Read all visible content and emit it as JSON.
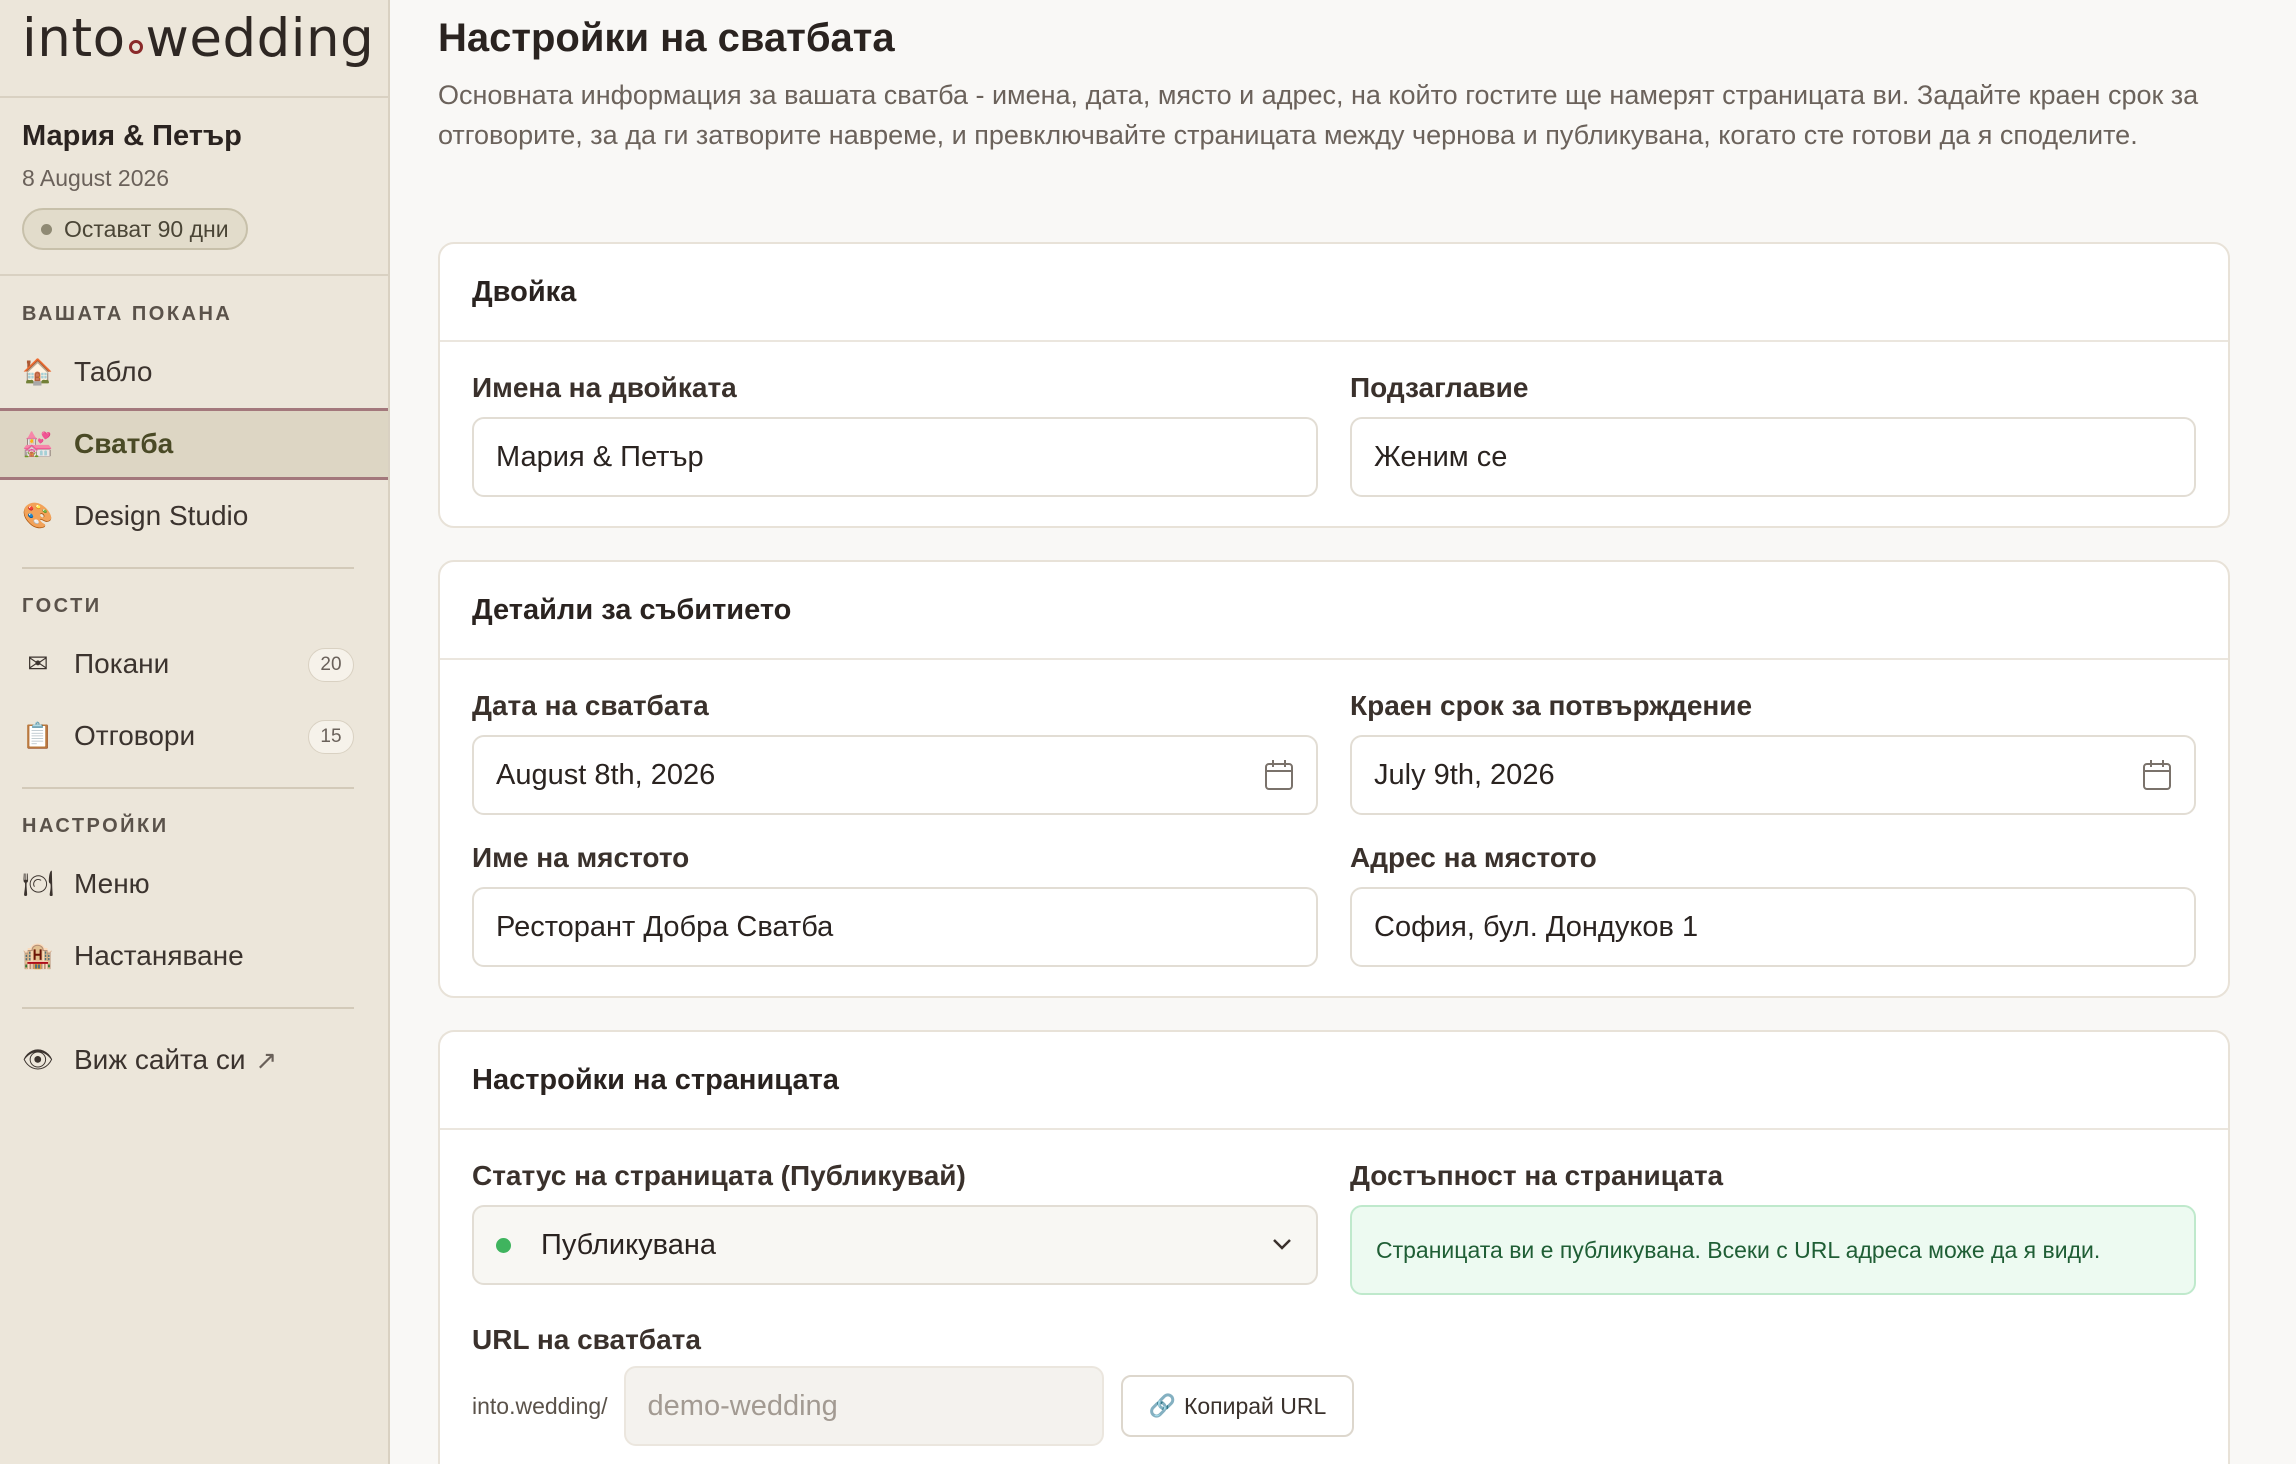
{
  "brand": {
    "logo_left": "into",
    "logo_right": "wedding"
  },
  "wedding": {
    "couple": "Мария & Петър",
    "date": "8 August 2026",
    "countdown": "Остават 90 дни"
  },
  "sidebar": {
    "sections": [
      {
        "title": "ВАШАТА ПОКАНА",
        "items": [
          {
            "label": "Табло",
            "icon": "house-icon"
          },
          {
            "label": "Сватба",
            "icon": "wedding-chapel-icon"
          },
          {
            "label": "Design Studio",
            "icon": "palette-icon"
          }
        ]
      },
      {
        "title": "ГОСТИ",
        "items": [
          {
            "label": "Покани",
            "icon": "envelope-icon",
            "count": "20"
          },
          {
            "label": "Отговори",
            "icon": "clipboard-icon",
            "count": "15"
          }
        ]
      },
      {
        "title": "НАСТРОЙКИ",
        "items": [
          {
            "label": "Меню",
            "icon": "fork-knife-plate-icon"
          },
          {
            "label": "Настаняване",
            "icon": "hotel-icon"
          }
        ]
      }
    ],
    "view_site": {
      "label": "Виж сайта си",
      "icon": "eye-icon",
      "arrow": "↗"
    }
  },
  "page": {
    "title": "Настройки на сватбата",
    "description": "Основната информация за вашата сватба - имена, дата, място и адрес, на който гостите ще намерят страницата ви. Задайте краен срок за отговорите, за да ги затворите навреме, и превключвайте страницата между чернова и публикувана, когато сте готови да я споделите."
  },
  "couple_card": {
    "title": "Двойка",
    "names_label": "Имена на двойката",
    "names_value": "Мария & Петър",
    "subtitle_label": "Подзаглавие",
    "subtitle_value": "Женим се"
  },
  "event_card": {
    "title": "Детайли за събитието",
    "date_label": "Дата на сватбата",
    "date_value": "August 8th, 2026",
    "deadline_label": "Краен срок за потвърждение",
    "deadline_value": "July 9th, 2026",
    "venue_label": "Име на мястото",
    "venue_value": "Ресторант Добра Сватба",
    "address_label": "Адрес на мястото",
    "address_value": "София, бул. Дондуков 1"
  },
  "page_card": {
    "title": "Настройки на страницата",
    "status_label": "Статус на страницата (Публикувай)",
    "status_value": "Публикувана",
    "visibility_label": "Достъпност на страницата",
    "visibility_text": "Страницата ви е публикувана. Всеки с URL адреса може да я види.",
    "url_label": "URL на сватбата",
    "url_prefix": "into.wedding/",
    "url_slug": "demo-wedding",
    "copy_label": "Копирай URL",
    "copy_icon": "link-icon"
  },
  "colors": {
    "accent_active_border": "#a3787c",
    "published_dot": "#3fb45e",
    "notice_bg": "#edfaf1"
  }
}
